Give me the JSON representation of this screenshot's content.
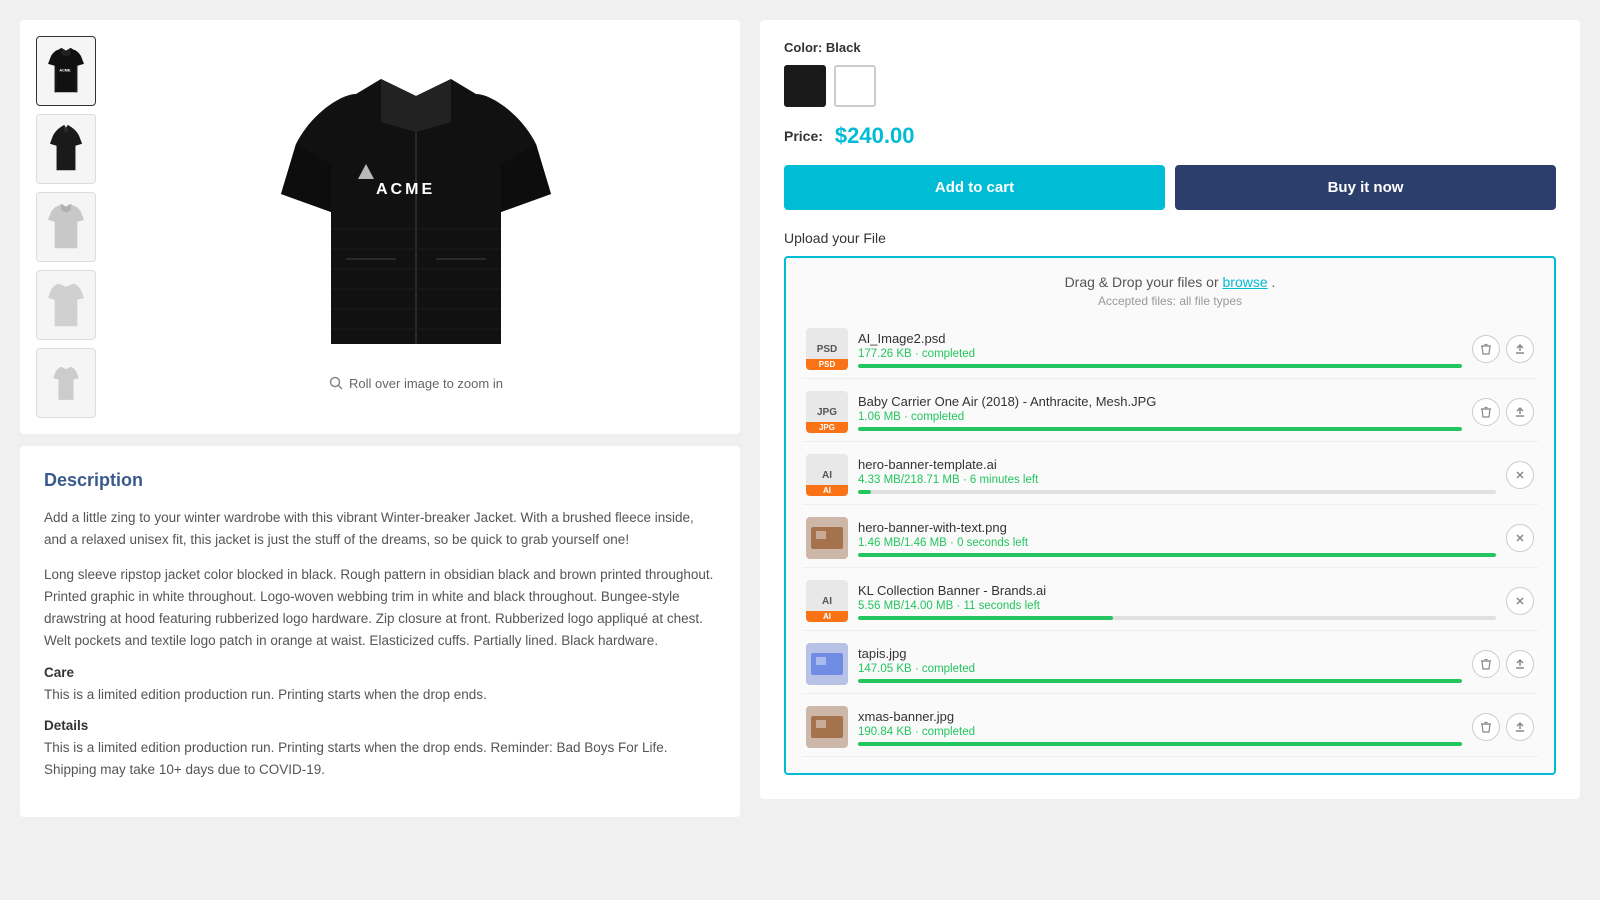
{
  "product": {
    "color_label": "Color:",
    "color_selected": "Black",
    "price_label": "Price:",
    "price": "$240.00",
    "btn_add_cart": "Add to cart",
    "btn_buy_now": "Buy it now",
    "upload_label": "Upload your File",
    "dropzone_text": "Drag & Drop your files or",
    "dropzone_link": "browse",
    "dropzone_period": ".",
    "dropzone_subtext": "Accepted files: all file types",
    "zoom_hint": "Roll over image to zoom in"
  },
  "description": {
    "title": "Description",
    "para1": "Add a little zing to your winter wardrobe with this vibrant Winter-breaker Jacket. With a brushed fleece inside, and a relaxed unisex fit, this jacket is just the stuff of the dreams, so be quick to grab yourself one!",
    "para2": "Long sleeve ripstop jacket color blocked in black. Rough pattern in obsidian black and brown printed throughout. Printed graphic in white throughout. Logo-woven webbing trim in white and black throughout. Bungee-style drawstring at hood featuring rubberized logo hardware. Zip closure at front. Rubberized logo appliqué at chest. Welt pockets and textile logo patch in orange at waist. Elasticized cuffs. Partially lined. Black hardware.",
    "care_label": "Care",
    "care_text": "This is a limited edition production run. Printing starts when the drop ends.",
    "details_label": "Details",
    "details_text": "This is a limited edition production run. Printing starts when the drop ends. Reminder: Bad Boys For Life. Shipping may take 10+ days due to COVID-19."
  },
  "files": [
    {
      "name": "AI_Image2.psd",
      "status": "177.26 KB · completed",
      "progress": 100,
      "type": "PSD",
      "completed": true,
      "uploading": false
    },
    {
      "name": "Baby Carrier One Air (2018) - Anthracite, Mesh.JPG",
      "status": "1.06 MB · completed",
      "progress": 100,
      "type": "JPG",
      "completed": true,
      "uploading": false
    },
    {
      "name": "hero-banner-template.ai",
      "status": "4.33 MB/218.71 MB · 6 minutes left",
      "progress": 2,
      "type": "AI",
      "completed": false,
      "uploading": true
    },
    {
      "name": "hero-banner-with-text.png",
      "status": "1.46 MB/1.46 MB · 0 seconds left",
      "progress": 100,
      "type": "PNG",
      "completed": false,
      "uploading": true,
      "has_thumb": true
    },
    {
      "name": "KL Collection Banner - Brands.ai",
      "status": "5.56 MB/14.00 MB · 11 seconds left",
      "progress": 40,
      "type": "AI",
      "completed": false,
      "uploading": true
    },
    {
      "name": "tapis.jpg",
      "status": "147.05 KB · completed",
      "progress": 100,
      "type": "JPG",
      "completed": true,
      "uploading": false,
      "has_thumb": true
    },
    {
      "name": "xmas-banner.jpg",
      "status": "190.84 KB · completed",
      "progress": 100,
      "type": "JPG",
      "completed": true,
      "uploading": false,
      "has_thumb": true
    }
  ],
  "thumbnails": [
    {
      "color": "dark",
      "label": "Black front"
    },
    {
      "color": "dark",
      "label": "Black side"
    },
    {
      "color": "light",
      "label": "White front"
    },
    {
      "color": "light",
      "label": "White back"
    },
    {
      "color": "light-small",
      "label": "White detail"
    }
  ]
}
